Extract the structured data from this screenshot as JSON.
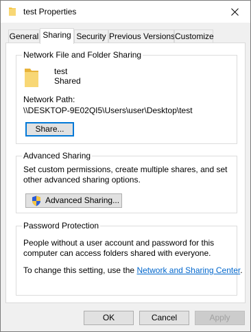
{
  "window": {
    "title": "test Properties",
    "close_glyph": "✕"
  },
  "tabs": [
    {
      "label": "General",
      "active": false
    },
    {
      "label": "Sharing",
      "active": true
    },
    {
      "label": "Security",
      "active": false
    },
    {
      "label": "Previous Versions",
      "active": false
    },
    {
      "label": "Customize",
      "active": false
    }
  ],
  "network_sharing": {
    "group_title": "Network File and Folder Sharing",
    "folder_name": "test",
    "folder_status": "Shared",
    "path_label": "Network Path:",
    "path_value": "\\\\DESKTOP-9E02QI5\\Users\\user\\Desktop\\test",
    "share_button": "Share..."
  },
  "advanced_sharing": {
    "group_title": "Advanced Sharing",
    "description": "Set custom permissions, create multiple shares, and set other advanced sharing options.",
    "button": "Advanced Sharing..."
  },
  "password_protection": {
    "group_title": "Password Protection",
    "description": "People without a user account and password for this computer can access folders shared with everyone.",
    "change_prefix": "To change this setting, use the ",
    "change_link": "Network and Sharing Center",
    "change_suffix": "."
  },
  "footer": {
    "ok": "OK",
    "cancel": "Cancel",
    "apply": "Apply"
  },
  "colors": {
    "folder": "#f5c542",
    "link": "#0066cc",
    "focus": "#0078d7"
  }
}
